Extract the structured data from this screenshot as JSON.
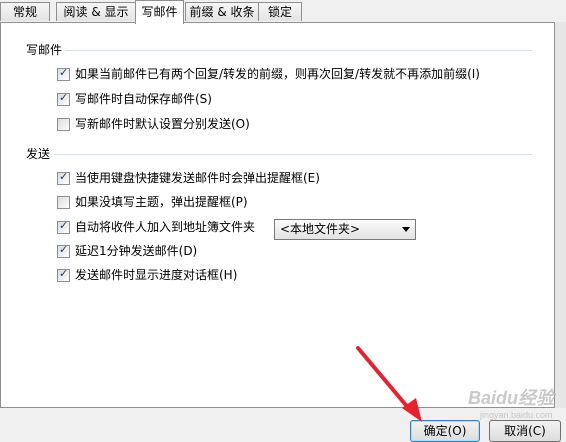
{
  "tabs": [
    {
      "label": "常规",
      "active": false
    },
    {
      "label": "阅读 & 显示",
      "active": false
    },
    {
      "label": "写邮件",
      "active": true
    },
    {
      "label": "前缀 & 收条",
      "active": false
    },
    {
      "label": "锁定",
      "active": false
    }
  ],
  "compose_group": {
    "title": "写邮件",
    "options": [
      {
        "label": "如果当前邮件已有两个回复/转发的前缀，则再次回复/转发就不再添加前缀(I)",
        "checked": true
      },
      {
        "label": "写邮件时自动保存邮件(S)",
        "checked": true
      },
      {
        "label": "写新邮件时默认设置分别发送(O)",
        "checked": false
      }
    ]
  },
  "send_group": {
    "title": "发送",
    "options": [
      {
        "label": "当使用键盘快捷键发送邮件时会弹出提醒框(E)",
        "checked": true
      },
      {
        "label": "如果没填写主题，弹出提醒框(P)",
        "checked": false
      },
      {
        "label": "自动将收件人加入到地址簿文件夹",
        "checked": true
      },
      {
        "label": "延迟1分钟发送邮件(D)",
        "checked": true
      },
      {
        "label": "发送邮件时显示进度对话框(H)",
        "checked": true
      }
    ],
    "folder_select": {
      "value": "<本地文件夹>"
    }
  },
  "buttons": {
    "ok": "确定(O)",
    "cancel": "取消(C)"
  },
  "watermark": {
    "logo": "Baidu经验",
    "sub": "jingyan.baidu.com"
  },
  "check_glyph": "✓",
  "colors": {
    "annotation_arrow": "#e8212f",
    "checkbox_tick": "#1e3c6e",
    "tab_border": "#8e8f8f",
    "ok_button_focus": "#3c7fb1"
  }
}
